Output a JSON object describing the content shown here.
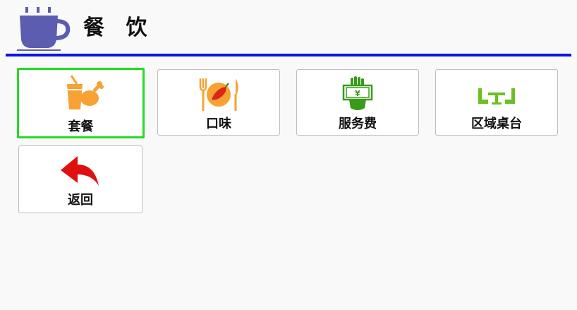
{
  "header": {
    "title": "餐 饮",
    "logo_icon": "coffee-cup-icon"
  },
  "colors": {
    "header_rule": "#0a14e6",
    "selected_border": "#22dd22",
    "icon_orange": "#f7a233",
    "icon_green": "#3a9a1a",
    "icon_red": "#e01010",
    "logo_purple": "#5c5cb0"
  },
  "tiles": [
    {
      "label": "套餐",
      "icon": "drink-and-chicken-leg-icon",
      "selected": true
    },
    {
      "label": "口味",
      "icon": "plate-fork-knife-pepper-icon",
      "selected": false
    },
    {
      "label": "服务费",
      "icon": "money-hand-icon",
      "selected": false
    },
    {
      "label": "区域桌台",
      "icon": "table-and-chairs-icon",
      "selected": false
    },
    {
      "label": "返回",
      "icon": "back-arrow-icon",
      "selected": false
    }
  ]
}
